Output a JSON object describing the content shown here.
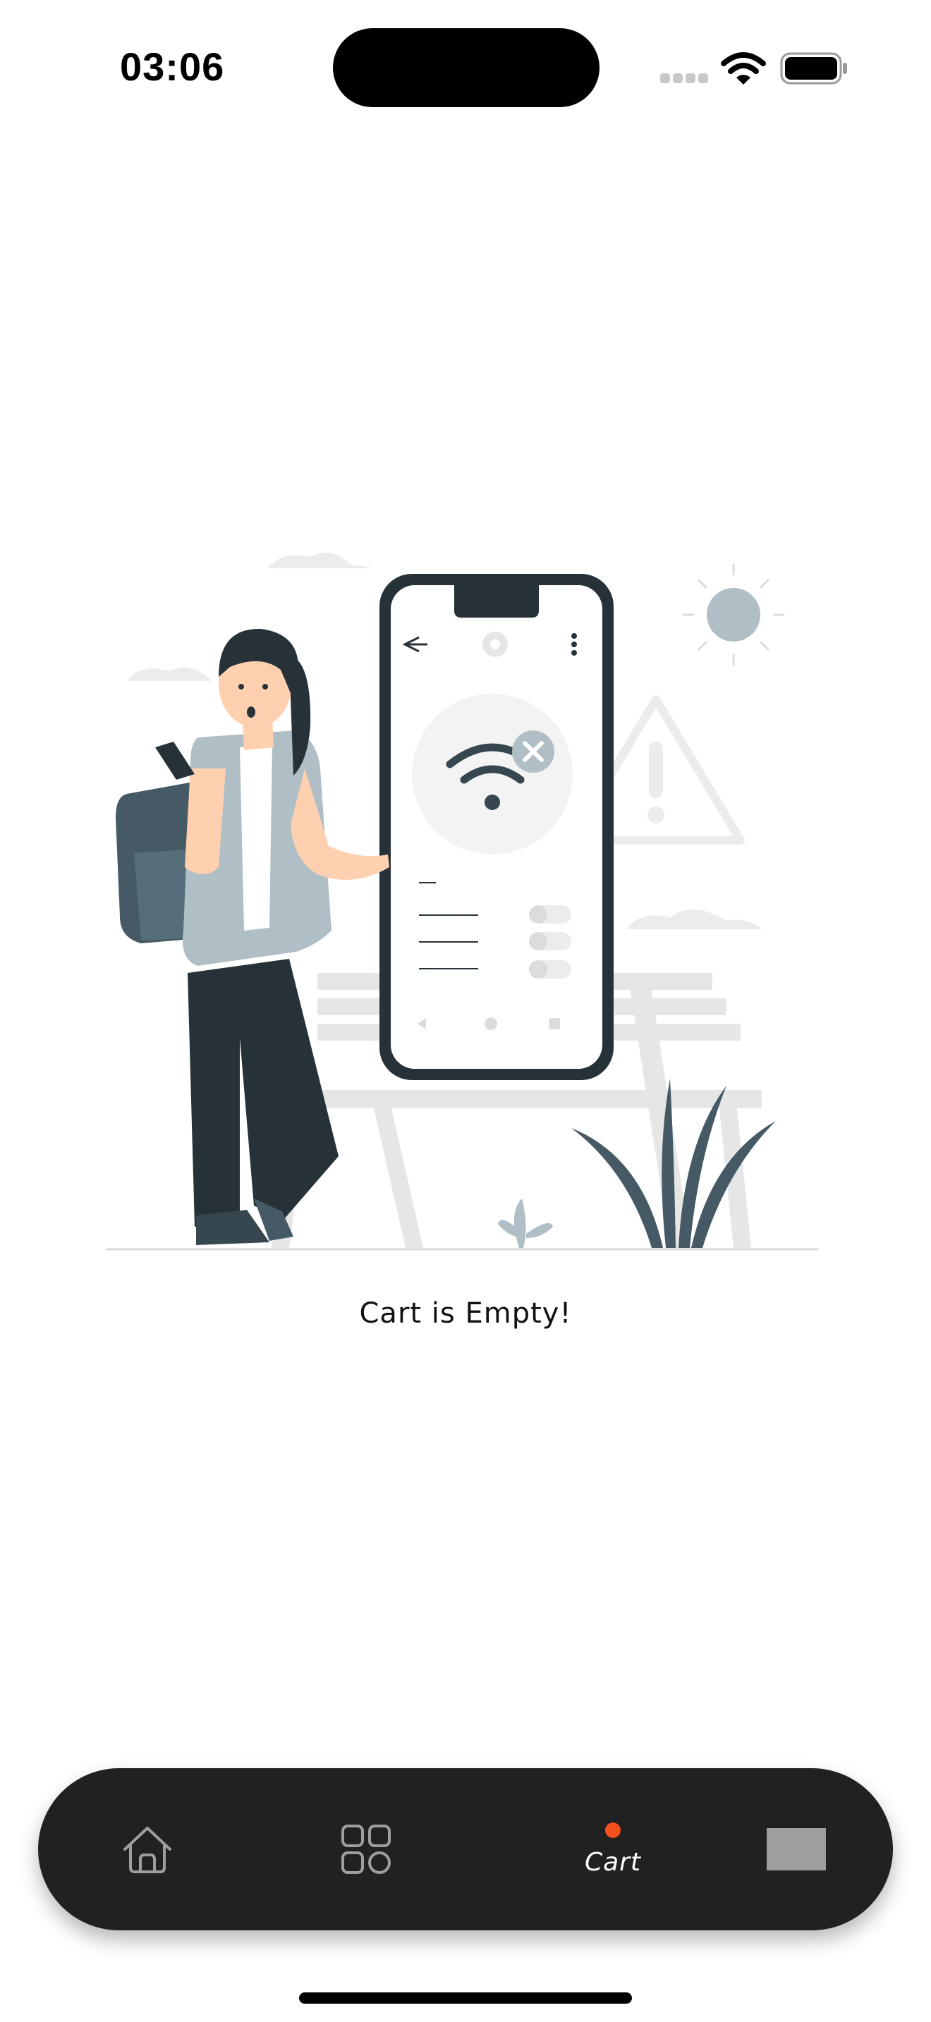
{
  "status_bar": {
    "time": "03:06",
    "icons": [
      "cellular-signal-icon",
      "wifi-icon",
      "battery-icon"
    ]
  },
  "main": {
    "illustration": "empty-cart-illustration",
    "message": "Cart is Empty!"
  },
  "tab_bar": {
    "tabs": [
      {
        "id": "home",
        "icon": "home-icon",
        "label": "",
        "active": false
      },
      {
        "id": "categories",
        "icon": "grid-icon",
        "label": "",
        "active": false
      },
      {
        "id": "cart",
        "icon": "",
        "label": "Cart",
        "active": true
      },
      {
        "id": "profile",
        "icon": "profile-placeholder",
        "label": "",
        "active": false
      }
    ],
    "active_indicator_color": "#F4511E"
  },
  "colors": {
    "background": "#FFFFFF",
    "tab_bar_background": "#212121",
    "text": "#111111"
  }
}
